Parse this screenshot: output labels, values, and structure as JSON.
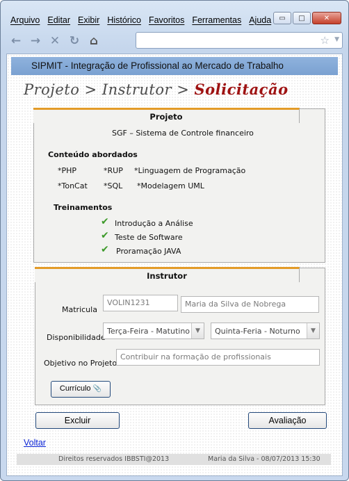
{
  "menu": [
    "Arquivo",
    "Editar",
    "Exibir",
    "Histórico",
    "Favoritos",
    "Ferramentas",
    "Ajuda"
  ],
  "window_controls": {
    "minimize": "▭",
    "maximize": "□",
    "close": "✕"
  },
  "nav_icons": {
    "back": "←",
    "forward": "→",
    "stop": "✕",
    "reload": "↻",
    "home": "⌂",
    "star": "☆",
    "dropdown": "▼"
  },
  "app": {
    "title": "SIPMIT - Integração de Profissional ao Mercado de Trabalho"
  },
  "breadcrumb": {
    "step1": "Projeto",
    "sep1": " > ",
    "step2": "Instrutor",
    "sep2": " > ",
    "current": "Solicitação"
  },
  "projeto": {
    "tab": "Projeto",
    "name": "SGF – Sistema de Controle financeiro",
    "conteudo_title": "Conteúdo abordados",
    "conteudo": [
      "*PHP",
      "*RUP",
      "*Linguagem de Programação",
      "*TonCat",
      "*SQL",
      "*Modelagem UML"
    ],
    "treinamentos_title": "Treinamentos",
    "treinamentos": [
      "Introdução a Análise",
      "Teste de Software",
      "Proramação JAVA"
    ],
    "check_icon": "✔"
  },
  "instrutor": {
    "tab": "Instrutor",
    "matricula_label": "Matricula",
    "matricula_value": "VOLIN1231",
    "nome_value": "Maria da Silva de Nobrega",
    "disponibilidade_label": "Disponibilidade",
    "disp1": "Terça-Feira - Matutino",
    "disp2": "Quinta-Feria - Noturno",
    "objetivo_label": "Objetivo no Projeto",
    "objetivo_value": "Contribuir na formação de profissionais",
    "curriculo_label": "Currículo",
    "clip_icon": "📎"
  },
  "actions": {
    "excluir": "Excluir",
    "avaliacao": "Avaliação",
    "voltar": "Voltar"
  },
  "footer": {
    "rights": "Direitos reservados IBBSTI@2013",
    "user_date": "Maria da Silva - 08/07/2013 15:30"
  }
}
